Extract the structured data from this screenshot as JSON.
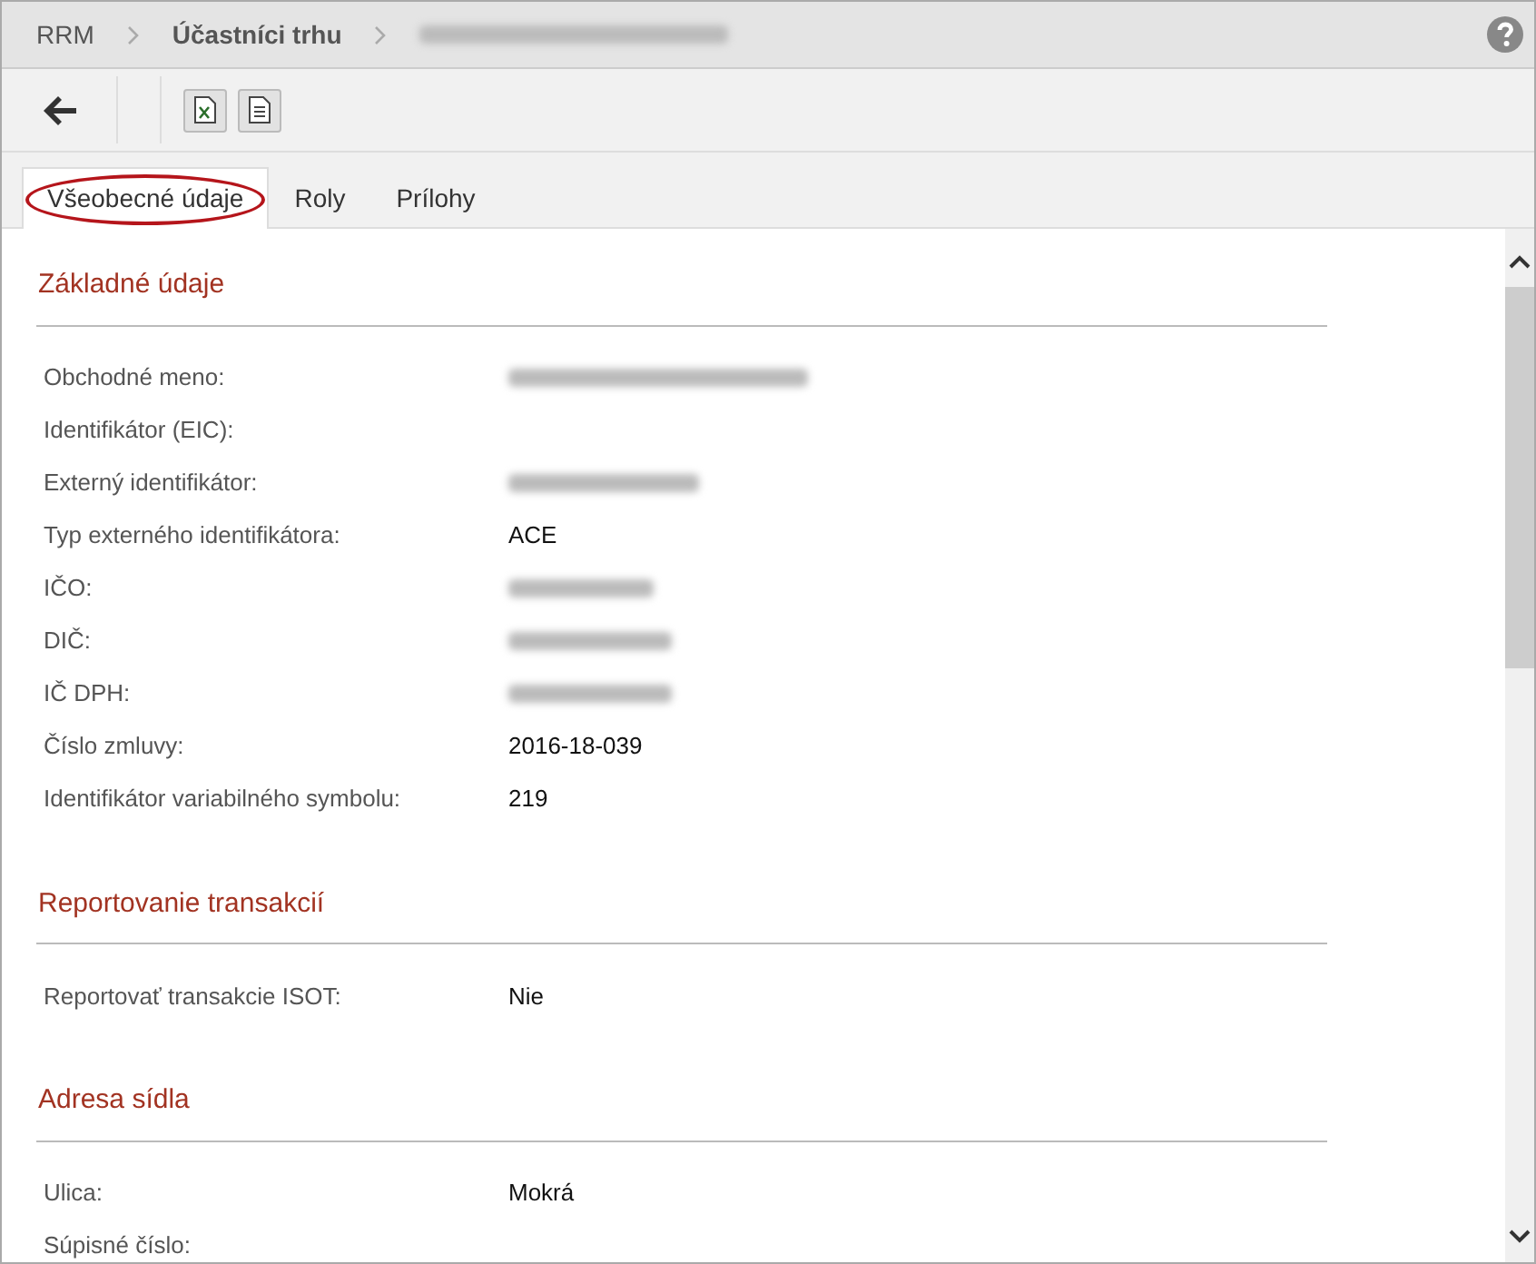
{
  "breadcrumb": [
    {
      "kind": "link",
      "label": "RRM"
    },
    {
      "kind": "current",
      "label": "Účastníci trhu"
    },
    {
      "kind": "blurred"
    }
  ],
  "tabs": [
    {
      "label": "Všeobecné údaje",
      "selected": true,
      "circled": true
    },
    {
      "label": "Roly",
      "selected": false,
      "circled": false
    },
    {
      "label": "Prílohy",
      "selected": false,
      "circled": false
    }
  ],
  "sections": [
    {
      "title": "Základné údaje",
      "fields": [
        {
          "kind": "blurred",
          "label": "Obchodné meno:"
        },
        {
          "kind": "empty",
          "label": "Identifikátor (EIC):"
        },
        {
          "kind": "blurred",
          "label": "Externý identifikátor:"
        },
        {
          "kind": "text",
          "label": "Typ externého identifikátora:",
          "value": "ACE"
        },
        {
          "kind": "blurred",
          "label": "IČO:"
        },
        {
          "kind": "blurred",
          "label": "DIČ:"
        },
        {
          "kind": "blurred",
          "label": "IČ DPH:"
        },
        {
          "kind": "text",
          "label": "Číslo zmluvy:",
          "value": "2016-18-039"
        },
        {
          "kind": "text",
          "label": "Identifikátor variabilného symbolu:",
          "value": "219"
        }
      ]
    },
    {
      "title": "Reportovanie transakcií",
      "fields": [
        {
          "kind": "text",
          "label": "Reportovať transakcie ISOT:",
          "value": "Nie"
        }
      ]
    },
    {
      "title": "Adresa sídla",
      "fields": [
        {
          "kind": "text",
          "label": "Ulica:",
          "value": "Mokrá"
        },
        {
          "kind": "empty",
          "label": "Súpisné číslo:"
        }
      ]
    }
  ]
}
